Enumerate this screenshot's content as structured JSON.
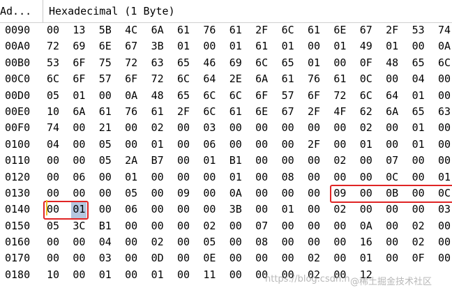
{
  "header": {
    "address_label": "Ad...",
    "data_label": "Hexadecimal (1 Byte)"
  },
  "rows": [
    {
      "address": "0090",
      "bytes": [
        "00",
        "13",
        "5B",
        "4C",
        "6A",
        "61",
        "76",
        "61",
        "2F",
        "6C",
        "61",
        "6E",
        "67",
        "2F",
        "53",
        "74"
      ]
    },
    {
      "address": "00A0",
      "bytes": [
        "72",
        "69",
        "6E",
        "67",
        "3B",
        "01",
        "00",
        "01",
        "61",
        "01",
        "00",
        "01",
        "49",
        "01",
        "00",
        "0A"
      ]
    },
    {
      "address": "00B0",
      "bytes": [
        "53",
        "6F",
        "75",
        "72",
        "63",
        "65",
        "46",
        "69",
        "6C",
        "65",
        "01",
        "00",
        "0F",
        "48",
        "65",
        "6C"
      ]
    },
    {
      "address": "00C0",
      "bytes": [
        "6C",
        "6F",
        "57",
        "6F",
        "72",
        "6C",
        "64",
        "2E",
        "6A",
        "61",
        "76",
        "61",
        "0C",
        "00",
        "04",
        "00"
      ]
    },
    {
      "address": "00D0",
      "bytes": [
        "05",
        "01",
        "00",
        "0A",
        "48",
        "65",
        "6C",
        "6C",
        "6F",
        "57",
        "6F",
        "72",
        "6C",
        "64",
        "01",
        "00"
      ]
    },
    {
      "address": "00E0",
      "bytes": [
        "10",
        "6A",
        "61",
        "76",
        "61",
        "2F",
        "6C",
        "61",
        "6E",
        "67",
        "2F",
        "4F",
        "62",
        "6A",
        "65",
        "63"
      ]
    },
    {
      "address": "00F0",
      "bytes": [
        "74",
        "00",
        "21",
        "00",
        "02",
        "00",
        "03",
        "00",
        "00",
        "00",
        "00",
        "00",
        "02",
        "00",
        "01",
        "00"
      ]
    },
    {
      "address": "0100",
      "bytes": [
        "04",
        "00",
        "05",
        "00",
        "01",
        "00",
        "06",
        "00",
        "00",
        "00",
        "2F",
        "00",
        "01",
        "00",
        "01",
        "00"
      ]
    },
    {
      "address": "0110",
      "bytes": [
        "00",
        "00",
        "05",
        "2A",
        "B7",
        "00",
        "01",
        "B1",
        "00",
        "00",
        "00",
        "02",
        "00",
        "07",
        "00",
        "00"
      ]
    },
    {
      "address": "0120",
      "bytes": [
        "00",
        "06",
        "00",
        "01",
        "00",
        "00",
        "00",
        "01",
        "00",
        "08",
        "00",
        "00",
        "00",
        "0C",
        "00",
        "01"
      ]
    },
    {
      "address": "0130",
      "bytes": [
        "00",
        "00",
        "00",
        "05",
        "00",
        "09",
        "00",
        "0A",
        "00",
        "00",
        "00",
        "09",
        "00",
        "0B",
        "00",
        "0C"
      ]
    },
    {
      "address": "0140",
      "bytes": [
        "00",
        "01",
        "00",
        "06",
        "00",
        "00",
        "00",
        "3B",
        "00",
        "01",
        "00",
        "02",
        "00",
        "00",
        "00",
        "03"
      ]
    },
    {
      "address": "0150",
      "bytes": [
        "05",
        "3C",
        "B1",
        "00",
        "00",
        "00",
        "02",
        "00",
        "07",
        "00",
        "00",
        "00",
        "0A",
        "00",
        "02",
        "00"
      ]
    },
    {
      "address": "0160",
      "bytes": [
        "00",
        "00",
        "04",
        "00",
        "02",
        "00",
        "05",
        "00",
        "08",
        "00",
        "00",
        "00",
        "16",
        "00",
        "02",
        "00"
      ]
    },
    {
      "address": "0170",
      "bytes": [
        "00",
        "00",
        "03",
        "00",
        "0D",
        "00",
        "0E",
        "00",
        "00",
        "00",
        "02",
        "00",
        "01",
        "00",
        "0F",
        "00"
      ]
    },
    {
      "address": "0180",
      "bytes": [
        "10",
        "00",
        "01",
        "00",
        "01",
        "00",
        "11",
        "00",
        "00",
        "00",
        "02",
        "00",
        "12",
        "",
        "",
        ""
      ]
    }
  ],
  "selected": {
    "row": 11,
    "col": 1
  },
  "highlights": [
    {
      "row": 10,
      "col_start": 11,
      "col_end": 15
    },
    {
      "row": 11,
      "col_start": 0,
      "col_end": 1
    }
  ],
  "watermark": {
    "left_text": "https://blog.csdn.n",
    "right_text": "@稀土掘金技术社区"
  },
  "colors": {
    "highlight_box": "#e02424",
    "selection": "#b5c7e0",
    "cursor": "#f0c020"
  }
}
